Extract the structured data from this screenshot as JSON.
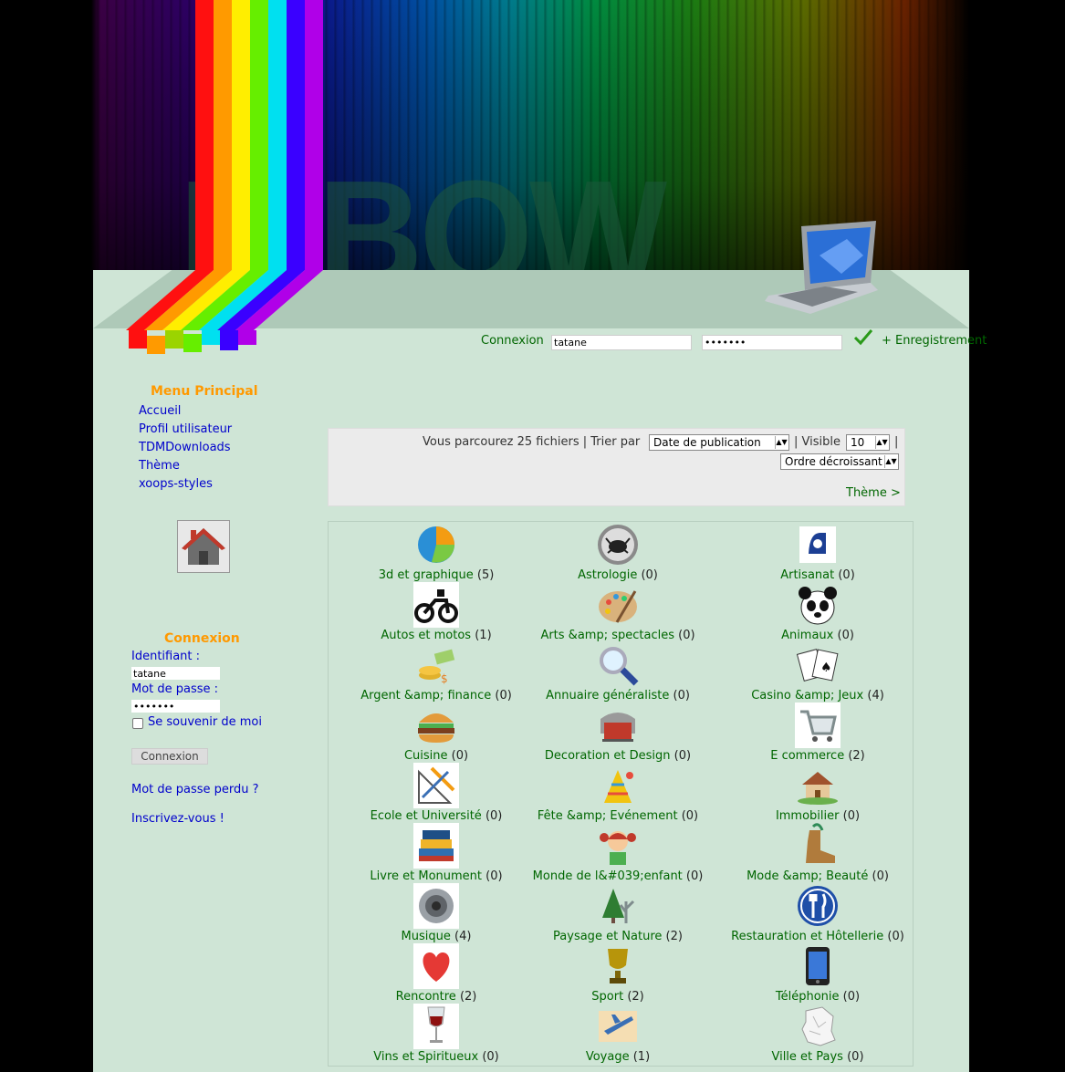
{
  "header": {
    "banner_text": "INBOW"
  },
  "topbar": {
    "login_label": "Connexion",
    "username_value": "tatane",
    "password_value": "•••••••",
    "register_label": "+ Enregistrement"
  },
  "main_menu": {
    "title": "Menu Principal",
    "items": [
      {
        "label": "Accueil"
      },
      {
        "label": "Profil utilisateur"
      },
      {
        "label": "TDMDownloads"
      },
      {
        "label": "Thème"
      },
      {
        "label": "xoops-styles"
      }
    ]
  },
  "login_block": {
    "title": "Connexion",
    "username_label": "Identifiant :",
    "username_value": "tatane",
    "password_label": "Mot de passe :",
    "password_value": "•••••••",
    "remember_label": "Se souvenir de moi",
    "submit_label": "Connexion",
    "lost_password": "Mot de passe perdu ?",
    "register": "Inscrivez-vous !"
  },
  "sort": {
    "browsing_text": "Vous parcourez 25 fichiers | Trier par",
    "sort_by_value": "Date de publication",
    "visible_text": "| Visible",
    "visible_value": "10",
    "trailing_pipe": "|",
    "order_value": "Ordre décroissant",
    "theme_link": "Thème >"
  },
  "categories": [
    {
      "name": "3d et graphique",
      "count": "(5)",
      "icon": "pie-chart-icon"
    },
    {
      "name": "Astrologie",
      "count": "(0)",
      "icon": "crab-zodiac-icon"
    },
    {
      "name": "Artisanat",
      "count": "(0)",
      "icon": "artisan-logo-icon"
    },
    {
      "name": "Autos et motos",
      "count": "(1)",
      "icon": "motorcycle-icon"
    },
    {
      "name": "Arts &amp; spectacles",
      "count": "(0)",
      "icon": "palette-icon"
    },
    {
      "name": "Animaux",
      "count": "(0)",
      "icon": "panda-icon"
    },
    {
      "name": "Argent &amp; finance",
      "count": "(0)",
      "icon": "money-icon"
    },
    {
      "name": "Annuaire généraliste",
      "count": "(0)",
      "icon": "magnifier-icon"
    },
    {
      "name": "Casino &amp; Jeux",
      "count": "(4)",
      "icon": "playing-cards-icon"
    },
    {
      "name": "Cuisine",
      "count": "(0)",
      "icon": "burger-icon"
    },
    {
      "name": "Decoration et Design",
      "count": "(0)",
      "icon": "design-chair-icon"
    },
    {
      "name": "E commerce",
      "count": "(2)",
      "icon": "shopping-cart-icon"
    },
    {
      "name": "Ecole et Université",
      "count": "(0)",
      "icon": "drafting-tools-icon"
    },
    {
      "name": "Fête &amp; Evénement",
      "count": "(0)",
      "icon": "party-icon"
    },
    {
      "name": "Immobilier",
      "count": "(0)",
      "icon": "house-icon"
    },
    {
      "name": "Livre et Monument",
      "count": "(0)",
      "icon": "books-icon"
    },
    {
      "name": "Monde de l&#039;enfant",
      "count": "(0)",
      "icon": "child-icon"
    },
    {
      "name": "Mode &amp; Beauté",
      "count": "(0)",
      "icon": "boot-icon"
    },
    {
      "name": "Musique",
      "count": "(4)",
      "icon": "speaker-icon"
    },
    {
      "name": "Paysage et Nature",
      "count": "(2)",
      "icon": "tree-icon"
    },
    {
      "name": "Restauration et Hôtellerie",
      "count": "(0)",
      "icon": "restaurant-icon"
    },
    {
      "name": "Rencontre",
      "count": "(2)",
      "icon": "heart-icon"
    },
    {
      "name": "Sport",
      "count": "(2)",
      "icon": "trophy-icon"
    },
    {
      "name": "Téléphonie",
      "count": "(0)",
      "icon": "smartphone-icon"
    },
    {
      "name": "Vins et Spiritueux",
      "count": "(0)",
      "icon": "wine-glass-icon"
    },
    {
      "name": "Voyage",
      "count": "(1)",
      "icon": "airplane-map-icon"
    },
    {
      "name": "Ville et Pays",
      "count": "(0)",
      "icon": "france-map-icon"
    }
  ]
}
